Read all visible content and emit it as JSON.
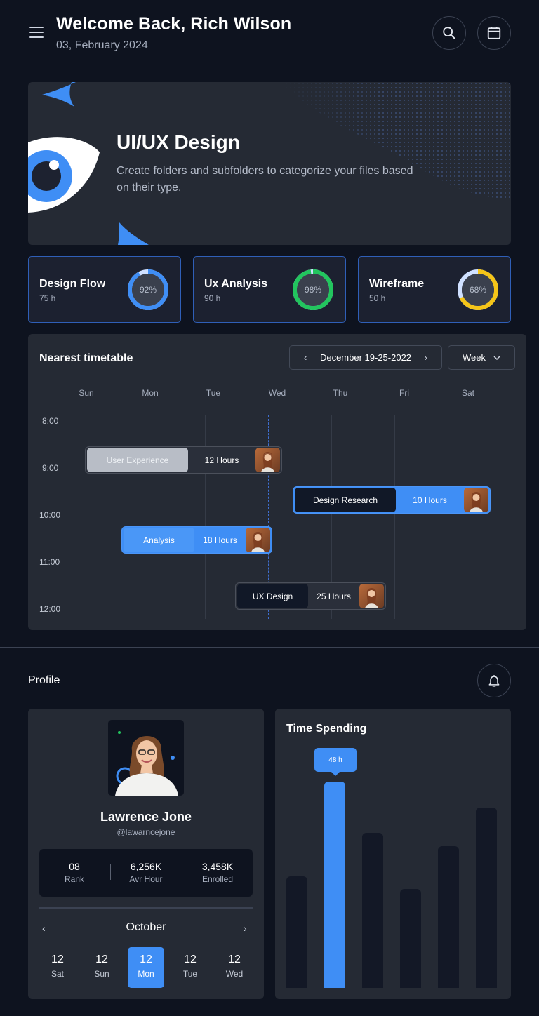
{
  "header": {
    "welcome": "Welcome Back, Rich Wilson",
    "date": "03, February 2024",
    "icons": [
      "menu-icon",
      "search-icon",
      "calendar-icon"
    ]
  },
  "hero": {
    "title": "UI/UX Design",
    "description": "Create folders and subfolders to categorize your files based on their type."
  },
  "stats": [
    {
      "title": "Design Flow",
      "hours": "75 h",
      "percent_label": "92%",
      "percent": 92,
      "color": "#3f8ef5"
    },
    {
      "title": "Ux Analysis",
      "hours": "90 h",
      "percent_label": "98%",
      "percent": 98,
      "color": "#22c55e"
    },
    {
      "title": "Wireframe",
      "hours": "50 h",
      "percent_label": "68%",
      "percent": 68,
      "color": "#f5c518"
    }
  ],
  "timetable": {
    "title": "Nearest timetable",
    "range": "December 19-25-2022",
    "view": "Week",
    "days": [
      "Sun",
      "Mon",
      "Tue",
      "Wed",
      "Thu",
      "Fri",
      "Sat"
    ],
    "times": [
      "8:00",
      "9:00",
      "10:00",
      "11:00",
      "12:00"
    ],
    "events": [
      {
        "name": "User Experience",
        "hours": "12 Hours"
      },
      {
        "name": "Design Research",
        "hours": "10 Hours"
      },
      {
        "name": "Analysis",
        "hours": "18 Hours"
      },
      {
        "name": "UX Design",
        "hours": "25 Hours"
      }
    ]
  },
  "profile": {
    "section_title": "Profile",
    "name": "Lawrence Jone",
    "handle": "@lawarncejone",
    "stats": [
      {
        "value": "08",
        "label": "Rank"
      },
      {
        "value": "6,256K",
        "label": "Avr Hour"
      },
      {
        "value": "3,458K",
        "label": "Enrolled"
      }
    ],
    "calendar": {
      "month": "October",
      "days": [
        {
          "num": "12",
          "weekday": "Sat"
        },
        {
          "num": "12",
          "weekday": "Sun"
        },
        {
          "num": "12",
          "weekday": "Mon"
        },
        {
          "num": "12",
          "weekday": "Tue"
        },
        {
          "num": "12",
          "weekday": "Wed"
        }
      ],
      "selected_index": 2
    }
  },
  "time_spending": {
    "title": "Time Spending",
    "tooltip": "48 h",
    "highlight_index": 1,
    "colors": {
      "bar": "#131826",
      "highlight": "#3f8ef5"
    }
  },
  "chart_data": {
    "type": "bar",
    "title": "Time Spending",
    "categories": [
      "",
      "",
      "",
      "",
      "",
      ""
    ],
    "values": [
      26,
      48,
      36,
      23,
      33,
      42
    ]
  }
}
